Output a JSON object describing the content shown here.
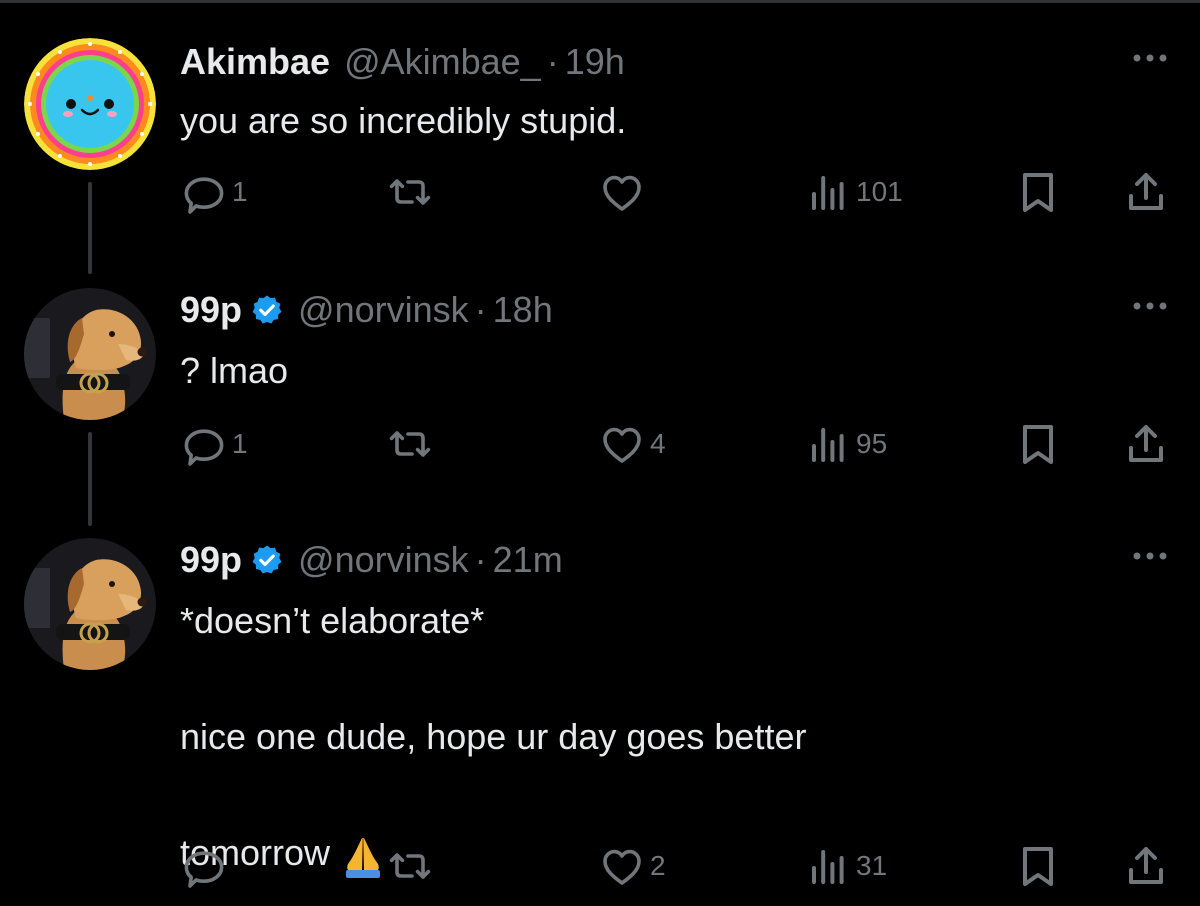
{
  "colors": {
    "background": "#000000",
    "text_primary": "#e7e9ea",
    "text_secondary": "#71767b",
    "verified_blue": "#1d9bf0",
    "thread_line": "#333639"
  },
  "tweets": [
    {
      "display_name": "Akimbae",
      "handle": "@Akimbae_",
      "separator": "·",
      "time": "19h",
      "verified": false,
      "text": "you are so incredibly stupid.",
      "avatar_icon": "colorful-smiley-avatar",
      "actions": {
        "reply_count": "1",
        "retweet_count": "",
        "like_count": "",
        "views_count": "101"
      }
    },
    {
      "display_name": "99p",
      "handle": "@norvinsk",
      "separator": "·",
      "time": "18h",
      "verified": true,
      "text": "? lmao",
      "avatar_icon": "puppy-with-collar-avatar",
      "actions": {
        "reply_count": "1",
        "retweet_count": "",
        "like_count": "4",
        "views_count": "95"
      }
    },
    {
      "display_name": "99p",
      "handle": "@norvinsk",
      "separator": "·",
      "time": "21m",
      "verified": true,
      "text_line1": "*doesn’t elaborate*",
      "text_line2": "nice one dude, hope ur day goes better",
      "text_line3": "tomorrow",
      "avatar_icon": "puppy-with-collar-avatar",
      "actions": {
        "reply_count": "",
        "retweet_count": "",
        "like_count": "2",
        "views_count": "31"
      }
    }
  ]
}
